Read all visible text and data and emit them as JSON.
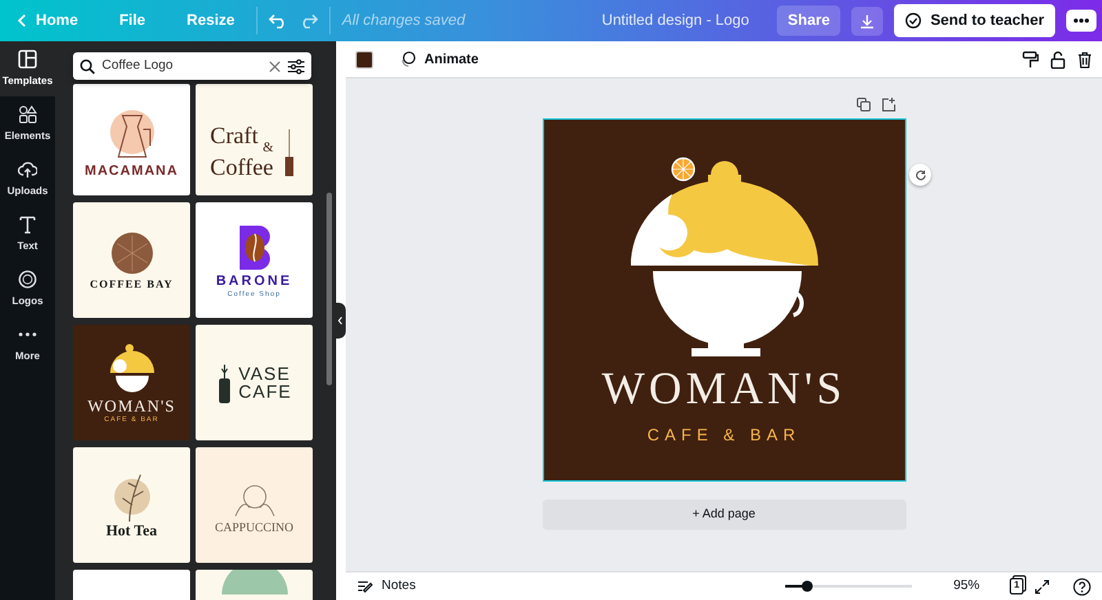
{
  "topbar": {
    "nav": [
      {
        "label": "Home",
        "kind": "back"
      },
      {
        "label": "File",
        "kind": "plain"
      },
      {
        "label": "Resize",
        "kind": "plain"
      }
    ],
    "save_status": "All changes saved",
    "design_title": "Untitled design - Logo",
    "share": "Share",
    "send": "Send to teacher"
  },
  "sidebar": {
    "items": [
      {
        "label": "Templates",
        "kind": "templates",
        "selected": true
      },
      {
        "label": "Elements",
        "kind": "elements",
        "selected": false
      },
      {
        "label": "Uploads",
        "kind": "uploads",
        "selected": false
      },
      {
        "label": "Text",
        "kind": "text",
        "selected": false
      },
      {
        "label": "Logos",
        "kind": "logos",
        "selected": false
      },
      {
        "label": "More",
        "kind": "more",
        "selected": false
      }
    ]
  },
  "search": {
    "value": "Coffee Logo"
  },
  "templates": [
    {
      "kind": "pot",
      "title": "MACAMANA"
    },
    {
      "kind": "craft",
      "title": "Craft",
      "title2": "Coffee",
      "amp": "&"
    },
    {
      "kind": "bean",
      "title": "COFFEE BAY"
    },
    {
      "kind": "letter",
      "title": "BARONE",
      "subtitle": "Coffee Shop"
    },
    {
      "kind": "dome",
      "title": "WOMAN'S",
      "subtitle": "CAFE & BAR"
    },
    {
      "kind": "vase",
      "title": "VASE",
      "title2": "CAFE"
    },
    {
      "kind": "leaf",
      "title": "Hot Tea"
    },
    {
      "kind": "cup",
      "title": "CAPPUCCINO"
    },
    {
      "kind": "blank"
    },
    {
      "kind": "badge"
    }
  ],
  "toolbar": {
    "animate": "Animate"
  },
  "design": {
    "title": "WOMAN'S",
    "subtitle": "CAFE & BAR",
    "selected": true
  },
  "add_page": "+ Add page",
  "bottom": {
    "notes": "Notes",
    "zoom": {
      "level": 0.17
    },
    "zoom_reading": "95%",
    "page_count": "1"
  }
}
